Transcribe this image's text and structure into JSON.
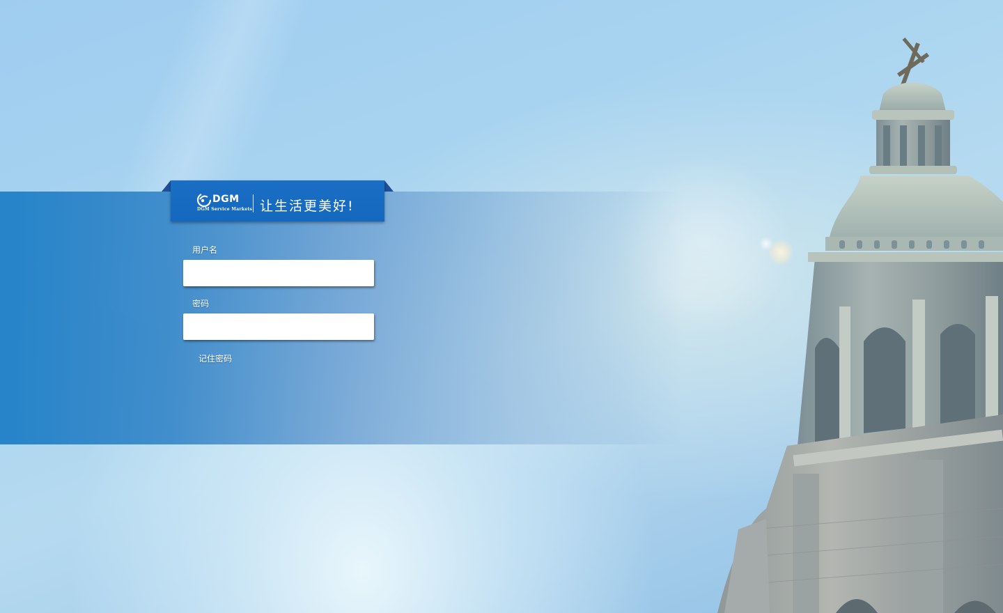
{
  "brand": {
    "logo_name": "DGM",
    "logo_subtitle": "DGM Service Markets",
    "slogan": "让生活更美好!"
  },
  "login_form": {
    "username_label": "用户名",
    "username_value": "",
    "password_label": "密码",
    "password_value": "",
    "remember_label": "记住密码"
  },
  "colors": {
    "band": "#2382c8",
    "ribbon": "#1a6fc4",
    "ribbon_fold": "#1e4f9a",
    "sky": "#a8d3f0"
  },
  "icons": {
    "logo": "dgm-swirl-logo"
  }
}
